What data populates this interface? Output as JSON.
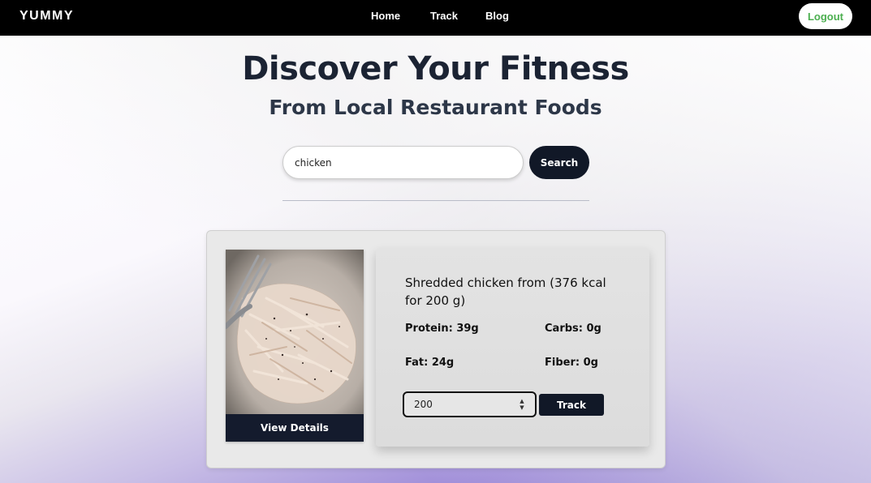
{
  "nav": {
    "brand": "YUMMY",
    "links": [
      "Home",
      "Track",
      "Blog"
    ],
    "logout_label": "Logout",
    "logout_color": "#4caf50"
  },
  "hero": {
    "title": "Discover Your Fitness",
    "subtitle": "From Local Restaurant Foods"
  },
  "search": {
    "value": "chicken",
    "button_label": "Search"
  },
  "result": {
    "image_icon": "shredded-chicken-photo",
    "view_details_label": "View Details",
    "food_name": "Shredded chicken from (376 kcal for 200 g)",
    "protein": "Protein: 39g",
    "carbs": "Carbs: 0g",
    "fat": "Fat: 24g",
    "fiber": "Fiber: 0g",
    "quantity": "200",
    "track_label": "Track"
  }
}
